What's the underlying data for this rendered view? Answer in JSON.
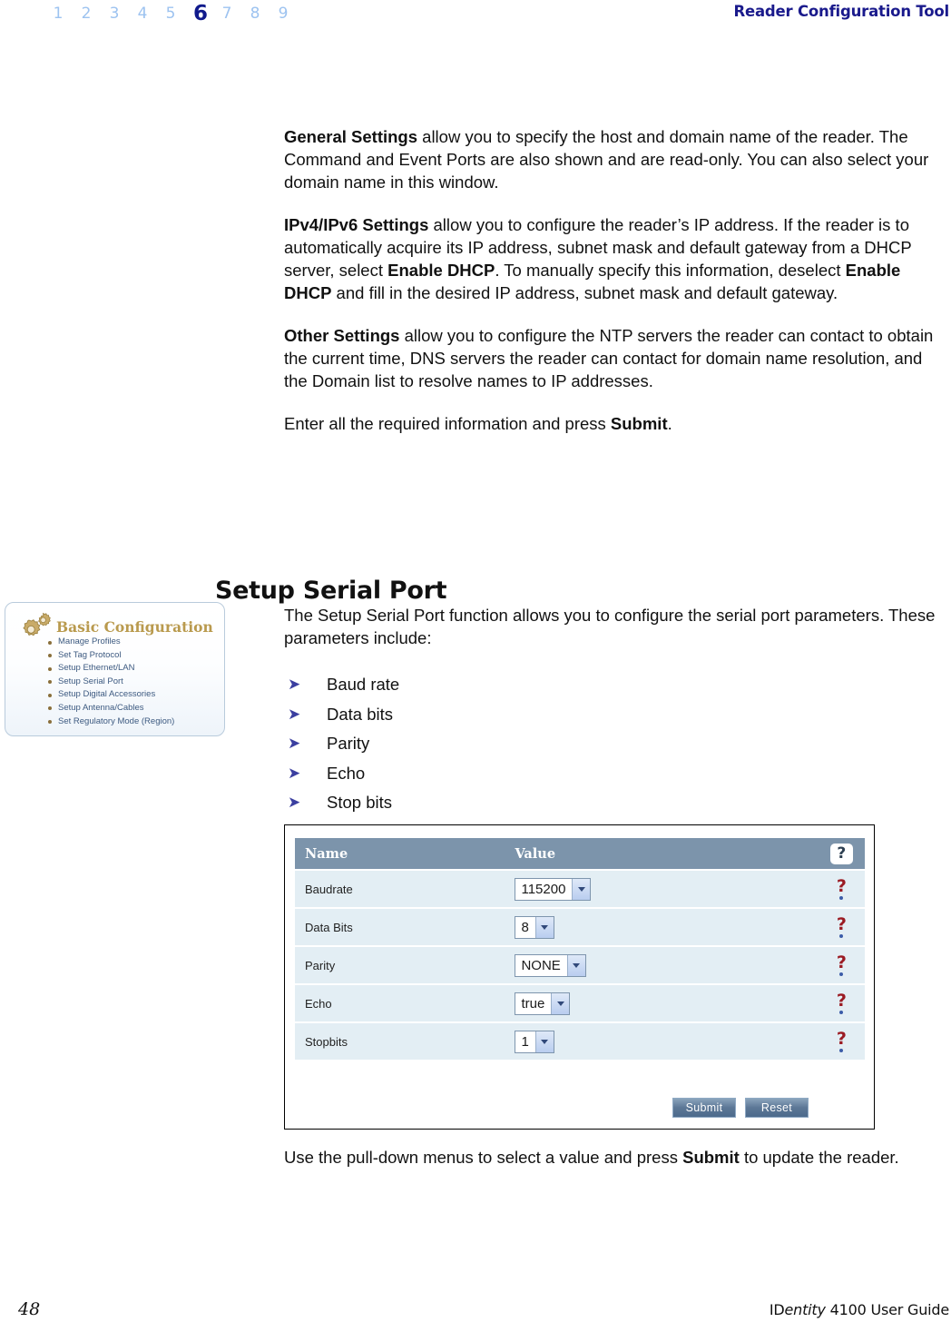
{
  "header": {
    "chapter_numbers": [
      "1",
      "2",
      "3",
      "4",
      "5",
      "6",
      "7",
      "8",
      "9"
    ],
    "current_chapter": "6",
    "title": "Reader Configuration Tool",
    "inactive_color": "#9dc3f0",
    "active_color": "#101a8c",
    "title_color": "#1a1a8c"
  },
  "body_paragraphs": [
    {
      "id": "general-settings",
      "runs": [
        {
          "text": "General Settings",
          "bold": true
        },
        {
          "text": " allow you to specify the host and domain name of the reader. The Command and Event Ports are also shown and are read-only. You can also select your domain name in this window.",
          "bold": false
        }
      ]
    },
    {
      "id": "ip-settings",
      "runs": [
        {
          "text": "IPv4/IPv6 Settings",
          "bold": true
        },
        {
          "text": " allow you to configure the reader’s IP address. If the reader is to automatically acquire its IP address, subnet mask and default gateway from a DHCP server, select ",
          "bold": false
        },
        {
          "text": "Enable DHCP",
          "bold": true
        },
        {
          "text": ". To manually specify this information, deselect ",
          "bold": false
        },
        {
          "text": "Enable DHCP",
          "bold": true
        },
        {
          "text": " and fill in the desired IP address, subnet mask and default gateway.",
          "bold": false
        }
      ]
    },
    {
      "id": "other-settings",
      "runs": [
        {
          "text": "Other Settings",
          "bold": true
        },
        {
          "text": " allow you to configure the NTP servers the reader can contact to obtain the current time, DNS servers the reader can contact for domain name resolution, and the Domain list to resolve names to IP addresses.",
          "bold": false
        }
      ]
    },
    {
      "id": "submit-instruction",
      "runs": [
        {
          "text": "Enter all the required information and press ",
          "bold": false
        },
        {
          "text": "Submit",
          "bold": true
        },
        {
          "text": ".",
          "bold": false
        }
      ]
    }
  ],
  "section": {
    "heading": "Setup Serial Port",
    "intro": "The Setup Serial Port function allows you to configure the serial port parameters. These parameters include:",
    "parameters": [
      "Baud rate",
      "Data bits",
      "Parity",
      "Echo",
      "Stop bits"
    ],
    "bullet_glyph": "➤",
    "bullet_color": "#3b3fa0"
  },
  "config_panel": {
    "title": "Basic Configuration",
    "title_color": "#b99a4e",
    "icon": "gear-icon",
    "items": [
      "Manage Profiles",
      "Set Tag Protocol",
      "Setup Ethernet/LAN",
      "Setup Serial Port",
      "Setup Digital Accessories",
      "Setup Antenna/Cables",
      "Set Regulatory Mode (Region)"
    ],
    "link_color": "#3d5a80"
  },
  "figure": {
    "caption": "",
    "table": {
      "columns": [
        "Name",
        "Value",
        "?"
      ],
      "header_bg": "#7c94ab",
      "row_bg": "#e3eef4",
      "rows": [
        {
          "name": "Baudrate",
          "value": "115200",
          "help": "?"
        },
        {
          "name": "Data Bits",
          "value": "8",
          "help": "?"
        },
        {
          "name": "Parity",
          "value": "NONE",
          "help": "?"
        },
        {
          "name": "Echo",
          "value": "true",
          "help": "?"
        },
        {
          "name": "Stopbits",
          "value": "1",
          "help": "?"
        }
      ]
    },
    "buttons": {
      "submit": "Submit",
      "reset": "Reset"
    }
  },
  "closing_paragraph": {
    "runs": [
      {
        "text": "Use the pull-down menus to select a value and press ",
        "bold": false
      },
      {
        "text": "Submit",
        "bold": true
      },
      {
        "text": " to update the reader.",
        "bold": false
      }
    ]
  },
  "footer": {
    "page_number": "48",
    "guide_prefix": "ID",
    "guide_italic": "entity",
    "guide_suffix": " 4100 User Guide"
  }
}
